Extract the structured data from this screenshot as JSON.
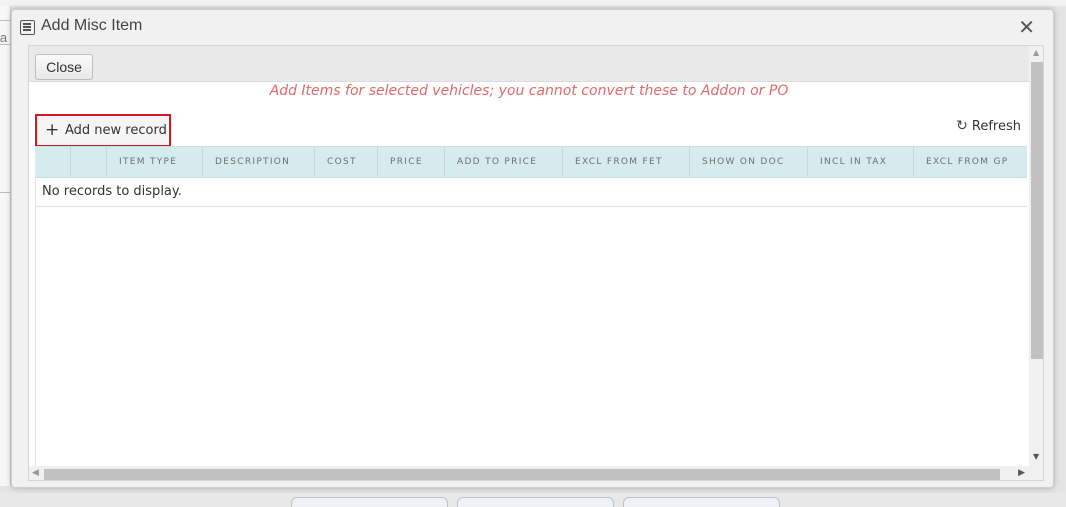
{
  "backdrop": {
    "left_text": "ia"
  },
  "window": {
    "title": "Add Misc Item",
    "close_symbol": "✕"
  },
  "toolbar": {
    "close_label": "Close"
  },
  "notice": "Add Items for selected vehicles; you cannot convert these to Addon or PO",
  "grid_toolbar": {
    "add_label": "Add new record",
    "add_icon": "+",
    "refresh_label": "Refresh",
    "refresh_icon": "↻"
  },
  "columns": [
    "",
    "",
    "ITEM TYPE",
    "DESCRIPTION",
    "COST",
    "PRICE",
    "ADD TO PRICE",
    "EXCL FROM FET",
    "SHOW ON DOC",
    "INCL IN TAX",
    "EXCL FROM GP"
  ],
  "empty_message": "No records to display.",
  "colors": {
    "header_bg": "#d4eced",
    "notice": "#e06b6b",
    "highlight_border": "#d6191f"
  }
}
